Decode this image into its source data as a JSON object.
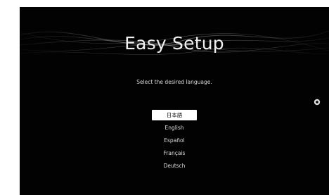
{
  "setup": {
    "title": "Easy Setup",
    "instruction": "Select the desired language."
  },
  "languages": [
    {
      "label": "日本語",
      "selected": true
    },
    {
      "label": "English",
      "selected": false
    },
    {
      "label": "Español",
      "selected": false
    },
    {
      "label": "Français",
      "selected": false
    },
    {
      "label": "Deutsch",
      "selected": false
    }
  ],
  "icons": {
    "options": "options-button-icon"
  },
  "colors": {
    "background": "#020202",
    "text": "#dcdcdc",
    "highlight": "#ffffff"
  }
}
